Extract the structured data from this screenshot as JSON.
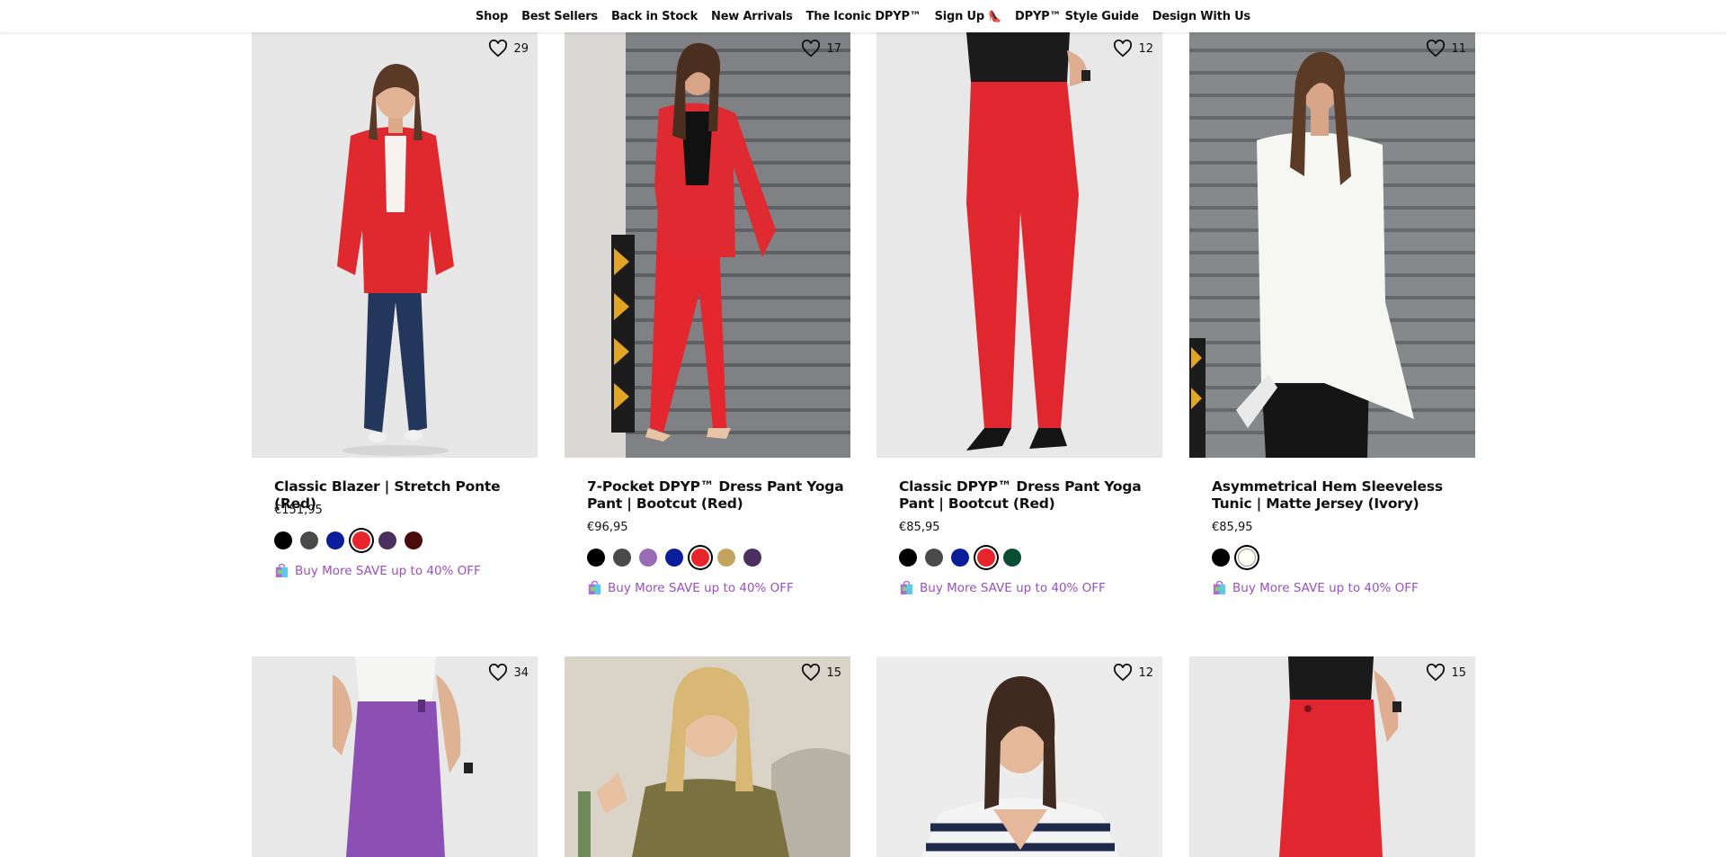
{
  "nav": {
    "items": [
      {
        "label": "Shop"
      },
      {
        "label": "Best Sellers"
      },
      {
        "label": "Back in Stock"
      },
      {
        "label": "New Arrivals"
      },
      {
        "label": "The Iconic DPYP™"
      },
      {
        "label": "Sign Up"
      },
      {
        "label": "DPYP™ Style Guide"
      },
      {
        "label": "Design With Us"
      }
    ]
  },
  "products": [
    {
      "title": "Classic Blazer | Stretch Ponte (Red)",
      "price": "€151,95",
      "likes": "29",
      "promo": "Buy More SAVE up to 40% OFF",
      "swatches": [
        "#000000",
        "#4a4a4a",
        "#0a1e9c",
        "#e8242b",
        "#4b2f5e",
        "#4a0b0b"
      ],
      "selected": 3
    },
    {
      "title": "7-Pocket DPYP™ Dress Pant Yoga Pant | Bootcut (Red)",
      "price": "€96,95",
      "likes": "17",
      "promo": "Buy More SAVE up to 40% OFF",
      "swatches": [
        "#000000",
        "#4a4a4a",
        "#9a6bb5",
        "#0a1e9c",
        "#e8242b",
        "#c4a560",
        "#4b2f5e"
      ],
      "selected": 4
    },
    {
      "title": "Classic DPYP™ Dress Pant Yoga Pant | Bootcut (Red)",
      "price": "€85,95",
      "likes": "12",
      "promo": "Buy More SAVE up to 40% OFF",
      "swatches": [
        "#000000",
        "#4a4a4a",
        "#0a1e9c",
        "#e8242b",
        "#0b4d35"
      ],
      "selected": 3
    },
    {
      "title": "Asymmetrical Hem Sleeveless Tunic | Matte Jersey (Ivory)",
      "price": "€85,95",
      "likes": "11",
      "promo": "Buy More SAVE up to 40% OFF",
      "swatches": [
        "#000000",
        "#fffff4"
      ],
      "selected": 1
    },
    {
      "likes": "34"
    },
    {
      "likes": "15"
    },
    {
      "likes": "12"
    },
    {
      "likes": "15"
    }
  ]
}
